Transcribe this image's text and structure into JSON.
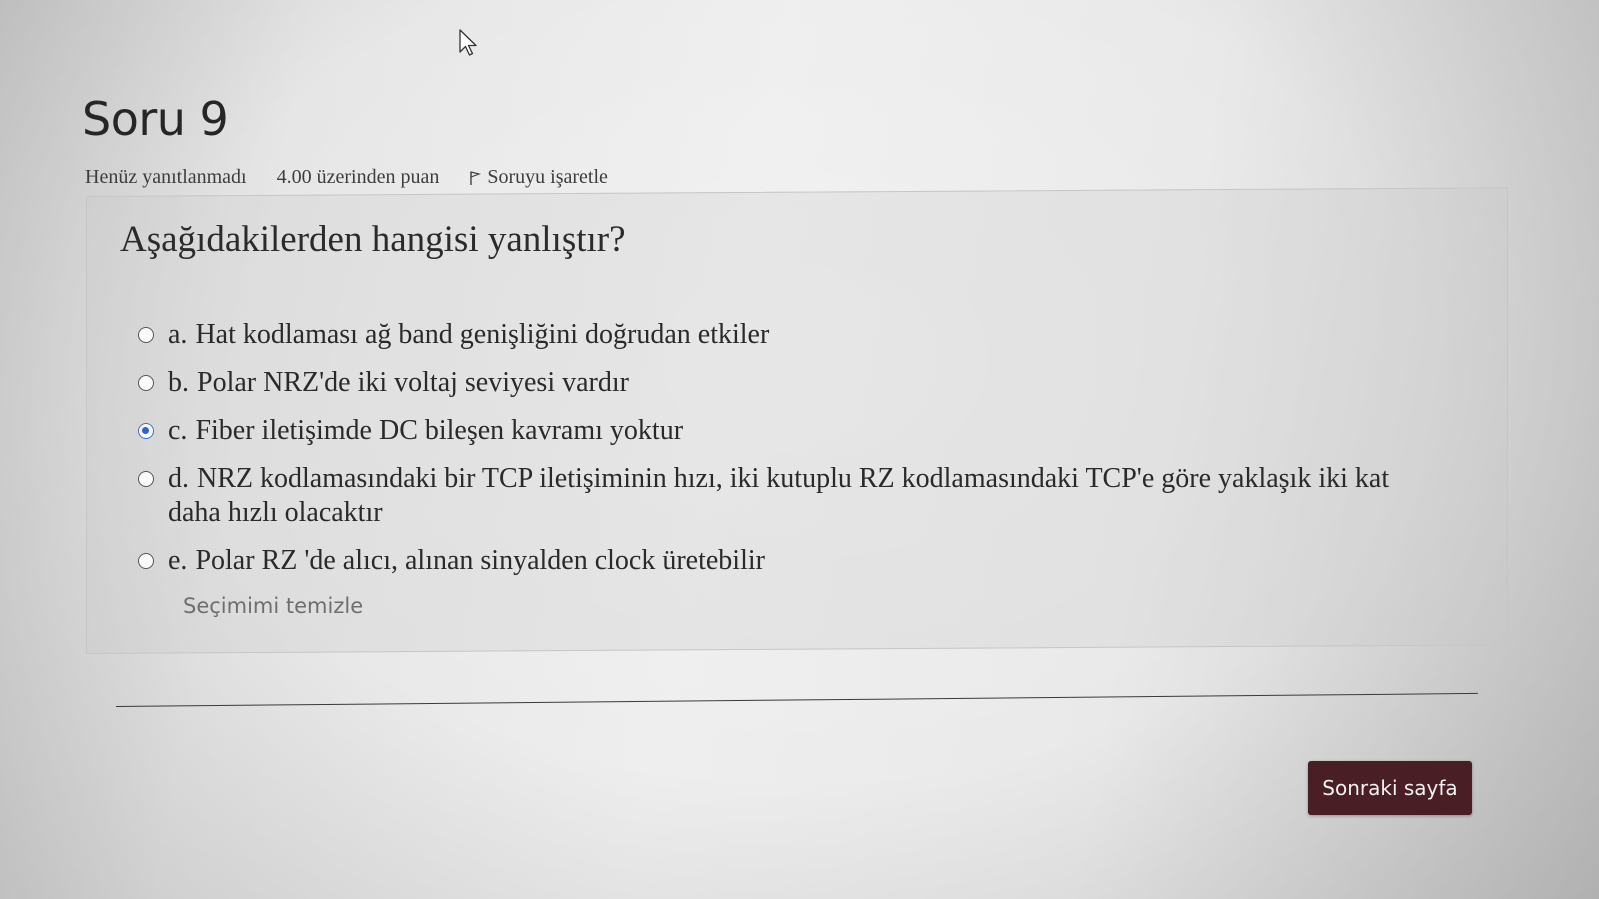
{
  "question": {
    "title": "Soru 9",
    "status": "Henüz yanıtlanmadı",
    "points": "4.00 üzerinden puan",
    "flag_label": "Soruyu işaretle",
    "text": "Aşağıdakilerden hangisi yanlıştır?",
    "options": [
      {
        "letter": "a.",
        "text": "Hat kodlaması ağ band genişliğini doğrudan etkiler",
        "selected": false
      },
      {
        "letter": "b.",
        "text": "Polar NRZ'de iki voltaj seviyesi vardır",
        "selected": false
      },
      {
        "letter": "c.",
        "text": "Fiber iletişimde DC bileşen kavramı yoktur",
        "selected": true
      },
      {
        "letter": "d.",
        "text": "NRZ kodlamasındaki bir TCP iletişiminin hızı, iki kutuplu RZ kodlamasındaki TCP'e göre yaklaşık iki kat daha hızlı olacaktır",
        "selected": false
      },
      {
        "letter": "e.",
        "text": "Polar RZ 'de alıcı, alınan sinyalden clock üretebilir",
        "selected": false
      }
    ],
    "clear_label": "Seçimimi temizle"
  },
  "navigation": {
    "next_label": "Sonraki sayfa"
  },
  "colors": {
    "next_button_bg": "#4a1e25",
    "radio_selected": "#2f62d1"
  }
}
